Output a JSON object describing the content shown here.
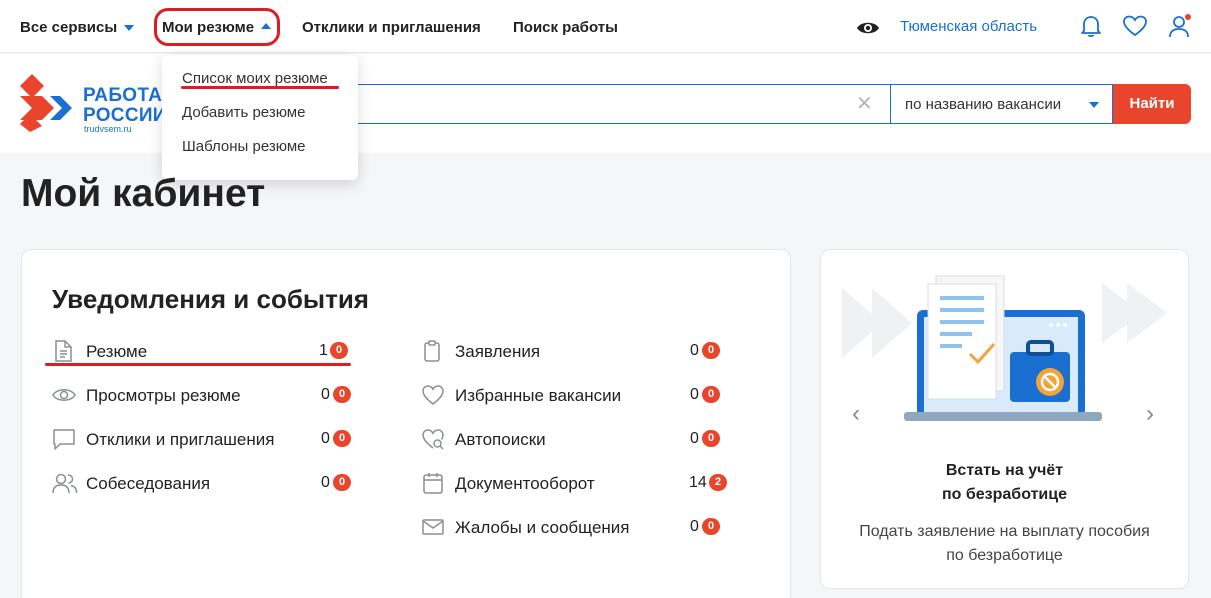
{
  "topnav": {
    "all_services": "Все сервисы",
    "my_resumes": "Мои резюме",
    "responses": "Отклики и приглашения",
    "job_search": "Поиск работы",
    "region": "Тюменская область"
  },
  "header": {
    "logo_line1": "РАБОТА",
    "logo_line2": "РОССИИ",
    "logo_sub": "trudvsem.ru",
    "search_mode": "по названию вакансии",
    "find_button": "Найти"
  },
  "dropdown": {
    "items": [
      "Список моих резюме",
      "Добавить резюме",
      "Шаблоны резюме"
    ]
  },
  "page": {
    "title": "Мой кабинет"
  },
  "notifications": {
    "title": "Уведомления и события",
    "left": [
      {
        "label": "Резюме",
        "count": "1",
        "badge": "0"
      },
      {
        "label": "Просмотры резюме",
        "count": "0",
        "badge": "0"
      },
      {
        "label": "Отклики и приглашения",
        "count": "0",
        "badge": "0"
      },
      {
        "label": "Собеседования",
        "count": "0",
        "badge": "0"
      }
    ],
    "right": [
      {
        "label": "Заявления",
        "count": "0",
        "badge": "0"
      },
      {
        "label": "Избранные вакансии",
        "count": "0",
        "badge": "0"
      },
      {
        "label": "Автопоиски",
        "count": "0",
        "badge": "0"
      },
      {
        "label": "Документооборот",
        "count": "14",
        "badge": "2"
      },
      {
        "label": "Жалобы и сообщения",
        "count": "0",
        "badge": "0"
      }
    ]
  },
  "promo": {
    "title_line1": "Встать на учёт",
    "title_line2": "по безработице",
    "desc_line1": "Подать заявление на выплату пособия",
    "desc_line2": "по безработице"
  },
  "colors": {
    "accent": "#1a6fd0",
    "brand_red": "#e8452c",
    "highlight_red": "#e01b24"
  }
}
